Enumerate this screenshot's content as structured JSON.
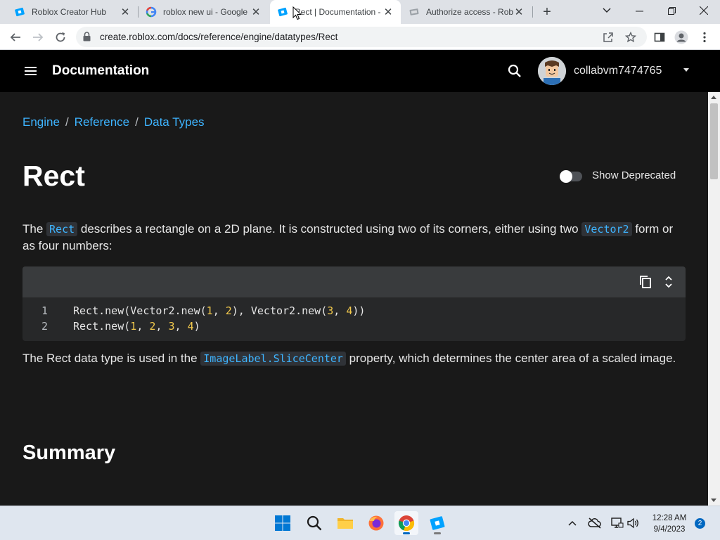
{
  "browser": {
    "tabs": [
      {
        "title": "Roblox Creator Hub",
        "icon": "roblox-studio-icon",
        "active": false
      },
      {
        "title": "roblox new ui - Google",
        "icon": "google-icon",
        "active": false
      },
      {
        "title": "Rect | Documentation -",
        "icon": "roblox-studio-icon",
        "active": true
      },
      {
        "title": "Authorize access - Rob",
        "icon": "authorize-icon",
        "active": false
      }
    ],
    "url": "create.roblox.com/docs/reference/engine/datatypes/Rect"
  },
  "site_header": {
    "title": "Documentation",
    "username": "collabvm7474765"
  },
  "breadcrumbs": [
    "Engine",
    "Reference",
    "Data Types"
  ],
  "page": {
    "title": "Rect",
    "toggle_label": "Show Deprecated",
    "intro": {
      "t1": "The ",
      "c1": "Rect",
      "t2": " describes a rectangle on a 2D plane. It is constructed using two of its corners, either using two ",
      "c2": "Vector2",
      "t3": " form or as four numbers:"
    },
    "code_lines": [
      {
        "num": "1",
        "a": "Rect.new(Vector2.new(",
        "n1": "1",
        "b": ", ",
        "n2": "2",
        "c": "), Vector2.new(",
        "n3": "3",
        "d": ", ",
        "n4": "4",
        "e": "))"
      },
      {
        "num": "2",
        "a": "Rect.new(",
        "n1": "1",
        "b": ", ",
        "n2": "2",
        "c": ", ",
        "n3": "3",
        "d": ", ",
        "n4": "4",
        "e": ")"
      }
    ],
    "para2": {
      "t1": "The Rect data type is used in the ",
      "c1": "ImageLabel.SliceCenter",
      "t2": " property, which determines the center area of a scaled image."
    },
    "summary_heading": "Summary"
  },
  "taskbar": {
    "time": "12:28 AM",
    "date": "9/4/2023",
    "notifications": "2"
  },
  "colors": {
    "link": "#3eb4ff",
    "background": "#191919",
    "header": "#000000",
    "number": "#f2c94c"
  }
}
